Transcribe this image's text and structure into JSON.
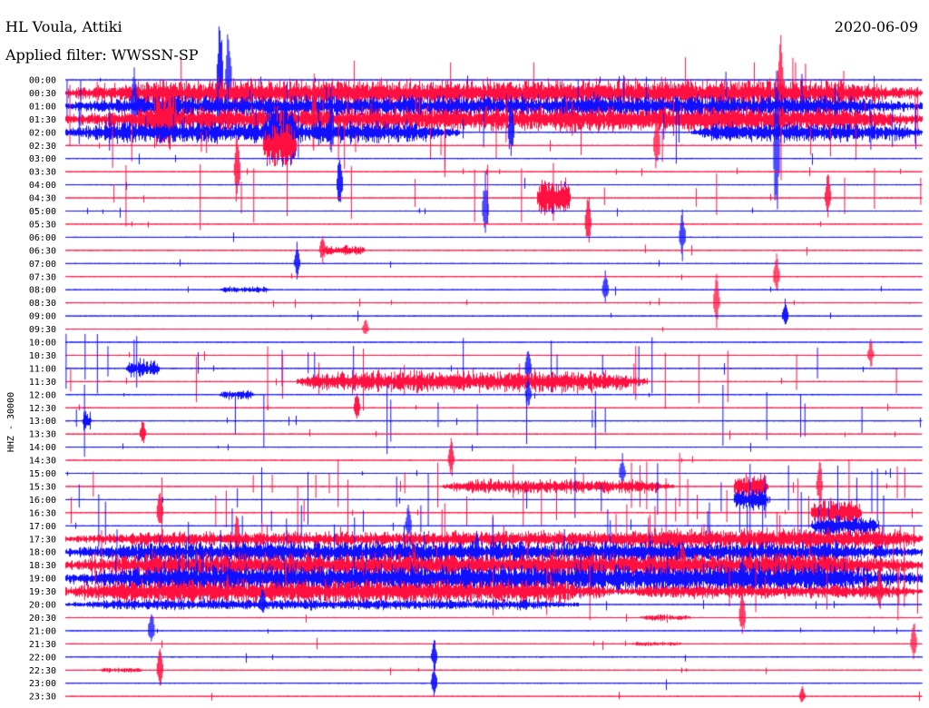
{
  "header": {
    "station": "HL Voula, Attiki",
    "filter": "Applied filter: WWSSN-SP",
    "date": "2020-06-09"
  },
  "chart_data": {
    "type": "line",
    "title": "HL Voula, Attiki",
    "subtitle": "Applied filter: WWSSN-SP",
    "date": "2020-06-09",
    "ylabel": "HHZ - 30000",
    "ticks": [
      "00:00",
      "00:30",
      "01:00",
      "01:30",
      "02:00",
      "02:30",
      "03:00",
      "03:30",
      "04:00",
      "04:30",
      "05:00",
      "05:30",
      "06:00",
      "06:30",
      "07:00",
      "07:30",
      "08:00",
      "08:30",
      "09:00",
      "09:30",
      "10:00",
      "10:30",
      "11:00",
      "11:30",
      "12:00",
      "12:30",
      "13:00",
      "13:30",
      "14:00",
      "14:30",
      "15:00",
      "15:30",
      "16:00",
      "16:30",
      "17:00",
      "17:30",
      "18:00",
      "18:30",
      "19:00",
      "19:30",
      "20:00",
      "20:30",
      "21:00",
      "21:30",
      "22:00",
      "22:30",
      "23:00",
      "23:30"
    ],
    "series_colors": [
      "#1010ff",
      "#ff1040"
    ],
    "baseline_amplitude": 0.4,
    "bursts": [
      {
        "row": 1,
        "x0": 0.0,
        "x1": 1.0,
        "amp": 18
      },
      {
        "row": 2,
        "x0": 0.0,
        "x1": 1.0,
        "amp": 14
      },
      {
        "row": 3,
        "x0": 0.0,
        "x1": 1.0,
        "amp": 16
      },
      {
        "row": 4,
        "x0": 0.0,
        "x1": 0.46,
        "amp": 14
      },
      {
        "row": 4,
        "x0": 0.73,
        "x1": 1.0,
        "amp": 12
      },
      {
        "row": 3,
        "x0": 0.5,
        "x1": 1.0,
        "amp": 12
      },
      {
        "row": 3,
        "x0": 0.1,
        "x1": 0.13,
        "amp": 40
      },
      {
        "row": 4,
        "x0": 0.23,
        "x1": 0.27,
        "amp": 45
      },
      {
        "row": 5,
        "x0": 0.23,
        "x1": 0.27,
        "amp": 30
      },
      {
        "row": 9,
        "x0": 0.55,
        "x1": 0.59,
        "amp": 25
      },
      {
        "row": 13,
        "x0": 0.3,
        "x1": 0.35,
        "amp": 7
      },
      {
        "row": 16,
        "x0": 0.18,
        "x1": 0.24,
        "amp": 4
      },
      {
        "row": 22,
        "x0": 0.07,
        "x1": 0.11,
        "amp": 12
      },
      {
        "row": 23,
        "x0": 0.27,
        "x1": 0.68,
        "amp": 14
      },
      {
        "row": 24,
        "x0": 0.18,
        "x1": 0.22,
        "amp": 6
      },
      {
        "row": 26,
        "x0": 0.02,
        "x1": 0.03,
        "amp": 12
      },
      {
        "row": 31,
        "x0": 0.44,
        "x1": 0.71,
        "amp": 9
      },
      {
        "row": 31,
        "x0": 0.78,
        "x1": 0.82,
        "amp": 18
      },
      {
        "row": 32,
        "x0": 0.78,
        "x1": 0.82,
        "amp": 14
      },
      {
        "row": 33,
        "x0": 0.87,
        "x1": 0.93,
        "amp": 18
      },
      {
        "row": 34,
        "x0": 0.87,
        "x1": 0.95,
        "amp": 14
      },
      {
        "row": 35,
        "x0": 0.0,
        "x1": 1.0,
        "amp": 10
      },
      {
        "row": 35,
        "x0": 0.64,
        "x1": 1.0,
        "amp": 14
      },
      {
        "row": 36,
        "x0": 0.0,
        "x1": 1.0,
        "amp": 14
      },
      {
        "row": 37,
        "x0": 0.0,
        "x1": 1.0,
        "amp": 16
      },
      {
        "row": 38,
        "x0": 0.0,
        "x1": 1.0,
        "amp": 18
      },
      {
        "row": 39,
        "x0": 0.0,
        "x1": 0.64,
        "amp": 16
      },
      {
        "row": 39,
        "x0": 0.64,
        "x1": 1.0,
        "amp": 9
      },
      {
        "row": 40,
        "x0": 0.0,
        "x1": 0.6,
        "amp": 7
      },
      {
        "row": 41,
        "x0": 0.67,
        "x1": 0.73,
        "amp": 4
      },
      {
        "row": 43,
        "x0": 0.66,
        "x1": 0.72,
        "amp": 3
      },
      {
        "row": 45,
        "x0": 0.04,
        "x1": 0.09,
        "amp": 3
      }
    ],
    "spikes": [
      {
        "row": 0,
        "x": 0.18,
        "amp": 90
      },
      {
        "row": 0,
        "x": 0.19,
        "amp": 70
      },
      {
        "row": 1,
        "x": 0.835,
        "amp": 80
      },
      {
        "row": 2,
        "x": 0.08,
        "amp": 55
      },
      {
        "row": 3,
        "x": 0.29,
        "amp": 60
      },
      {
        "row": 4,
        "x": 0.31,
        "amp": 40
      },
      {
        "row": 4,
        "x": 0.52,
        "amp": 45
      },
      {
        "row": 5,
        "x": 0.69,
        "amp": 50
      },
      {
        "row": 6,
        "x": 0.83,
        "amp": 110
      },
      {
        "row": 7,
        "x": 0.2,
        "amp": 55
      },
      {
        "row": 8,
        "x": 0.32,
        "amp": 45
      },
      {
        "row": 9,
        "x": 0.89,
        "amp": 35
      },
      {
        "row": 10,
        "x": 0.49,
        "amp": 45
      },
      {
        "row": 11,
        "x": 0.61,
        "amp": 40
      },
      {
        "row": 12,
        "x": 0.72,
        "amp": 35
      },
      {
        "row": 13,
        "x": 0.3,
        "amp": 20
      },
      {
        "row": 14,
        "x": 0.27,
        "amp": 25
      },
      {
        "row": 15,
        "x": 0.83,
        "amp": 30
      },
      {
        "row": 16,
        "x": 0.63,
        "amp": 25
      },
      {
        "row": 17,
        "x": 0.76,
        "amp": 40
      },
      {
        "row": 18,
        "x": 0.84,
        "amp": 20
      },
      {
        "row": 19,
        "x": 0.35,
        "amp": 15
      },
      {
        "row": 21,
        "x": 0.94,
        "amp": 20
      },
      {
        "row": 22,
        "x": 0.54,
        "amp": 30
      },
      {
        "row": 24,
        "x": 0.54,
        "amp": 25
      },
      {
        "row": 25,
        "x": 0.34,
        "amp": 25
      },
      {
        "row": 27,
        "x": 0.09,
        "amp": 20
      },
      {
        "row": 29,
        "x": 0.45,
        "amp": 30
      },
      {
        "row": 30,
        "x": 0.65,
        "amp": 25
      },
      {
        "row": 31,
        "x": 0.88,
        "amp": 40
      },
      {
        "row": 33,
        "x": 0.11,
        "amp": 35
      },
      {
        "row": 34,
        "x": 0.4,
        "amp": 30
      },
      {
        "row": 35,
        "x": 0.2,
        "amp": 35
      },
      {
        "row": 36,
        "x": 0.48,
        "amp": 30
      },
      {
        "row": 37,
        "x": 0.72,
        "amp": 35
      },
      {
        "row": 38,
        "x": 0.79,
        "amp": 35
      },
      {
        "row": 39,
        "x": 0.95,
        "amp": 35
      },
      {
        "row": 40,
        "x": 0.23,
        "amp": 25
      },
      {
        "row": 41,
        "x": 0.79,
        "amp": 40
      },
      {
        "row": 42,
        "x": 0.1,
        "amp": 30
      },
      {
        "row": 43,
        "x": 0.99,
        "amp": 30
      },
      {
        "row": 44,
        "x": 0.43,
        "amp": 25
      },
      {
        "row": 45,
        "x": 0.11,
        "amp": 30
      },
      {
        "row": 46,
        "x": 0.43,
        "amp": 25
      },
      {
        "row": 47,
        "x": 0.86,
        "amp": 15
      }
    ]
  }
}
